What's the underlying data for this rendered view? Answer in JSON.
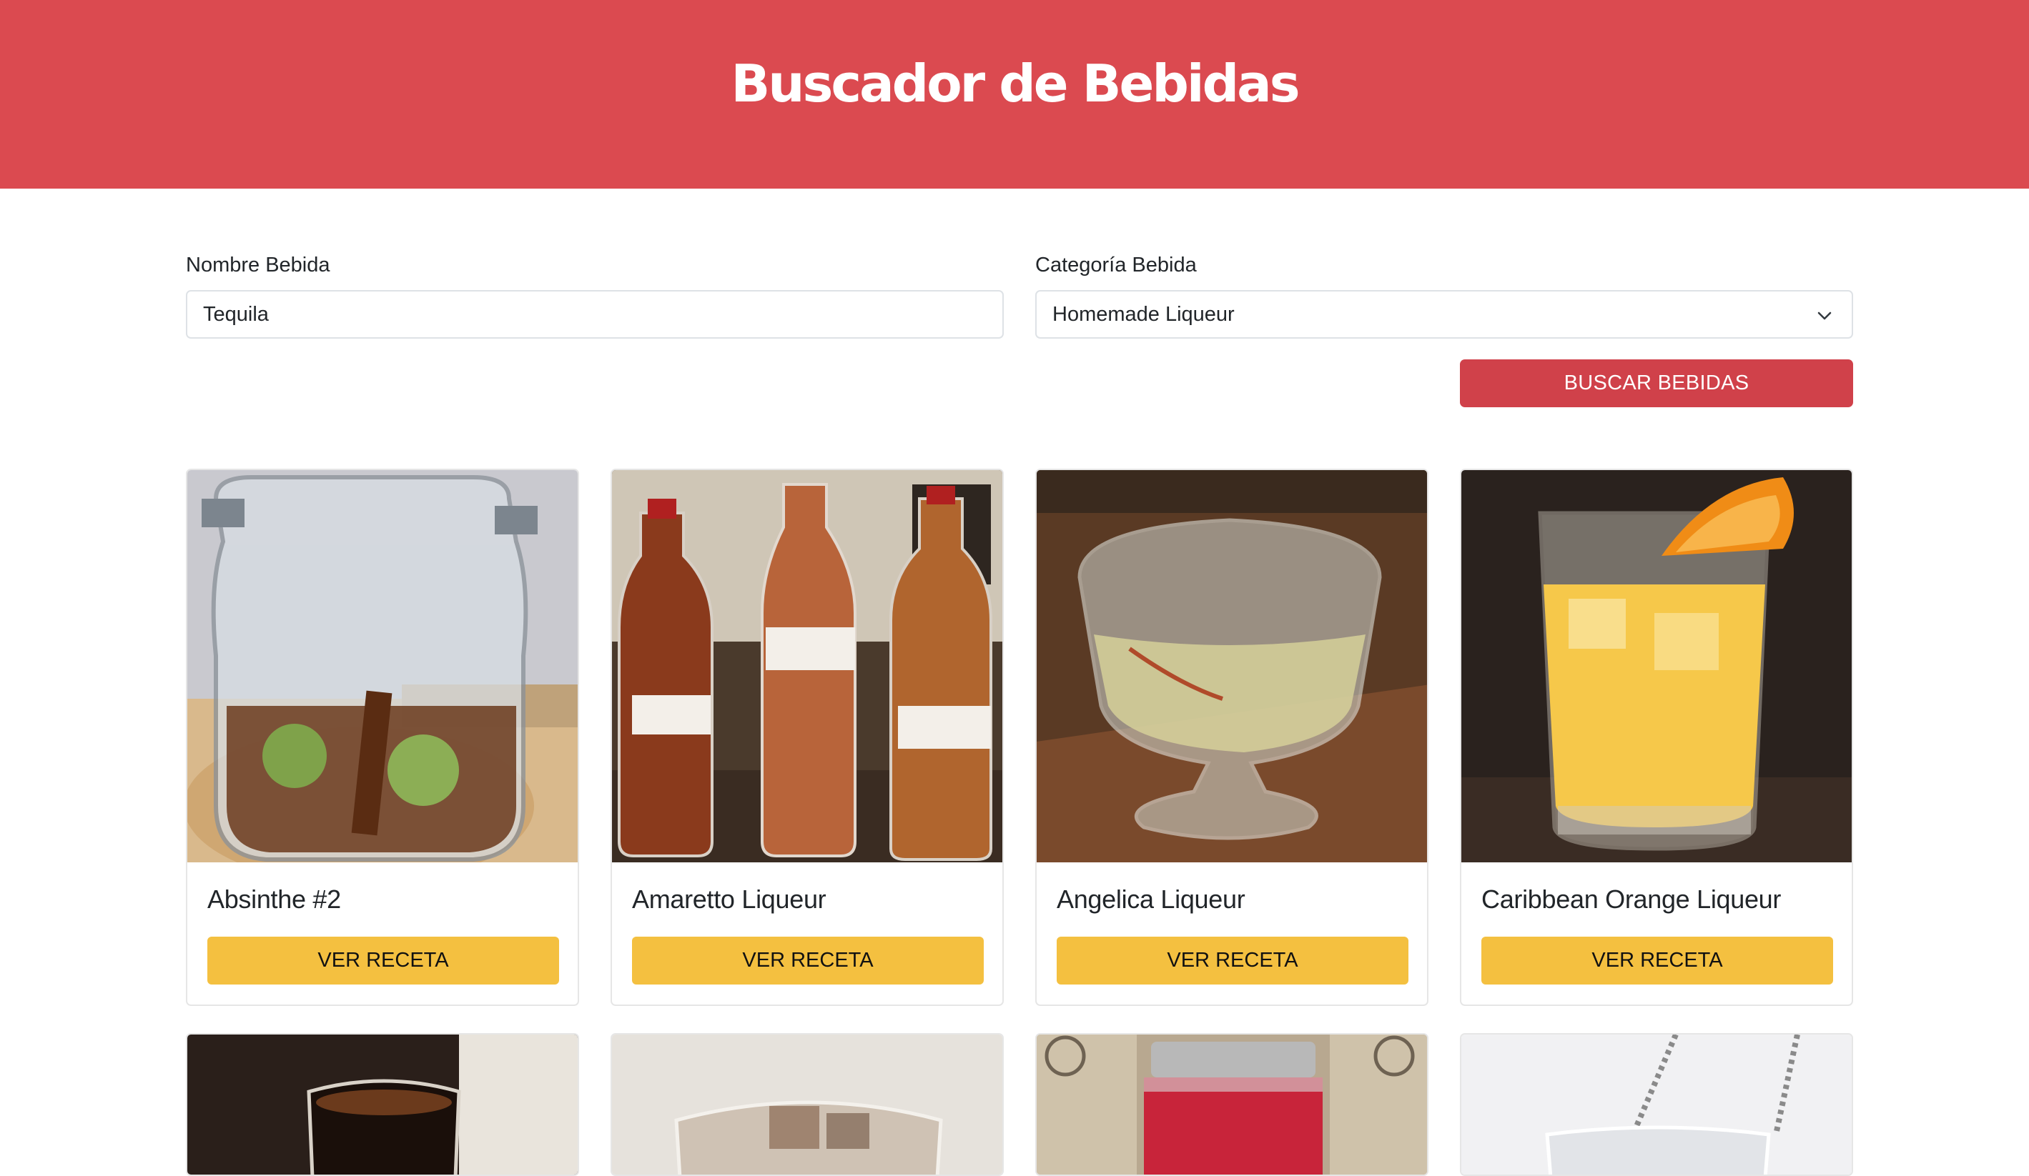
{
  "header": {
    "title": "Buscador de Bebidas",
    "bg_color": "#db4a50"
  },
  "form": {
    "name_label": "Nombre Bebida",
    "name_value": "Tequila",
    "category_label": "Categoría Bebida",
    "category_value": "Homemade Liqueur",
    "search_button": "BUSCAR BEBIDAS",
    "search_button_color": "#d0414a"
  },
  "drinks": [
    {
      "name": "Absinthe #2",
      "button": "VER RECETA",
      "image": "jar-liqueur-photo"
    },
    {
      "name": "Amaretto Liqueur",
      "button": "VER RECETA",
      "image": "amaretto-bottles-photo"
    },
    {
      "name": "Angelica Liqueur",
      "button": "VER RECETA",
      "image": "glass-liqueur-photo"
    },
    {
      "name": "Caribbean Orange Liqueur",
      "button": "VER RECETA",
      "image": "orange-drink-photo"
    },
    {
      "image": "dark-shot-glass-photo"
    },
    {
      "image": "iced-coffee-photo"
    },
    {
      "image": "red-jam-jar-photo"
    },
    {
      "image": "cocktail-glass-photo"
    }
  ],
  "colors": {
    "recipe_button": "#f4c040"
  }
}
